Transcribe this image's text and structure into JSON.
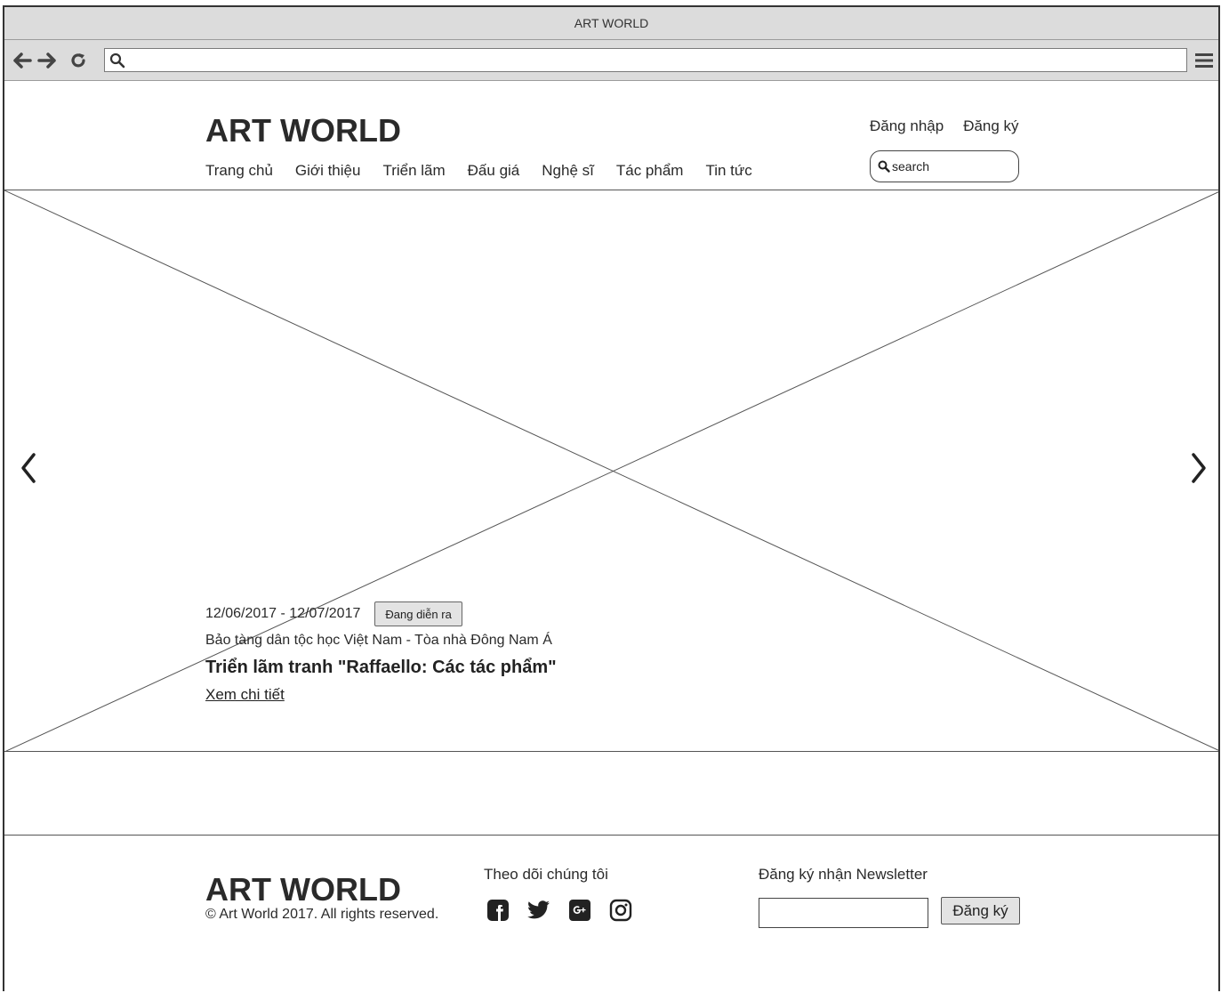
{
  "browser": {
    "title": "ART WORLD",
    "address_value": "",
    "icons": {
      "back": "arrow-left-icon",
      "forward": "arrow-right-icon",
      "reload": "reload-icon",
      "search": "search-icon",
      "menu": "hamburger-menu-icon"
    }
  },
  "header": {
    "logo": "ART WORLD",
    "nav": [
      "Trang chủ",
      "Giới thiệu",
      "Triển lãm",
      "Đấu giá",
      "Nghệ sĩ",
      "Tác phẩm",
      "Tin tức"
    ],
    "login": "Đăng nhập",
    "register": "Đăng ký",
    "search_placeholder": "search"
  },
  "hero": {
    "dates": "12/06/2017 - 12/07/2017",
    "status_badge": "Đang diễn ra",
    "location": "Bảo tàng dân tộc học Việt Nam - Tòa nhà Đông Nam Á",
    "title": "Triển lãm tranh \"Raffaello: Các tác phẩm\"",
    "link": "Xem chi tiết",
    "prev_icon": "chevron-left-icon",
    "next_icon": "chevron-right-icon"
  },
  "footer": {
    "logo": "ART WORLD",
    "copyright": "© Art World 2017. All rights reserved.",
    "follow_label": "Theo dõi chúng tôi",
    "socials": [
      "facebook-icon",
      "twitter-icon",
      "google-plus-icon",
      "instagram-icon"
    ],
    "newsletter_label": "Đăng ký nhận Newsletter",
    "newsletter_value": "",
    "newsletter_button": "Đăng ký"
  },
  "colors": {
    "chrome": "#dcdcdc",
    "text": "#2a2a2a",
    "border": "#555555",
    "button": "#e3e3e3"
  }
}
